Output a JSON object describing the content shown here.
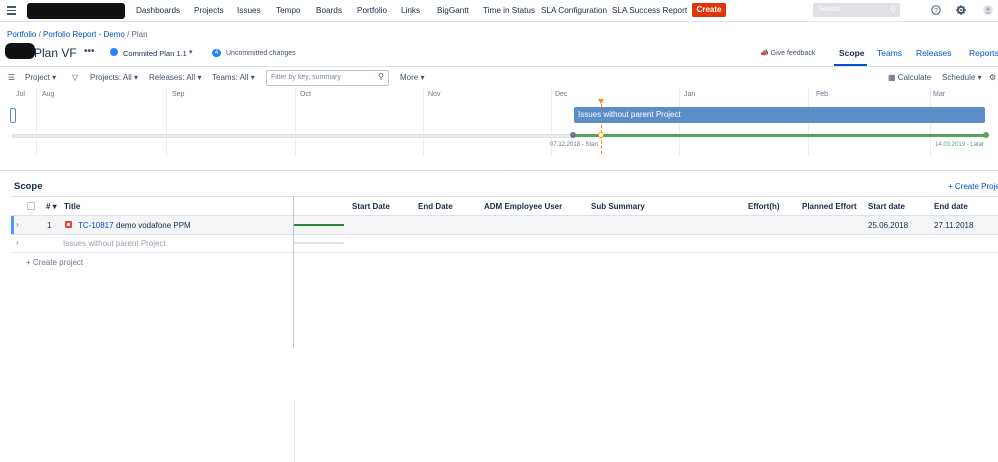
{
  "nav": {
    "items": [
      "Dashboards",
      "Projects",
      "Issues",
      "Tempo",
      "Boards",
      "Portfolio",
      "Links",
      "BigGantt",
      "Time in Status",
      "SLA Configuration",
      "SLA Success Report"
    ],
    "create_label": "Create",
    "search_placeholder": "Search",
    "brand_color": "#de350b"
  },
  "breadcrumb": {
    "portfolio": "Portfolio",
    "report": "Porfolio Report - Demo",
    "current": "Plan"
  },
  "plan": {
    "title": "Plan VF",
    "more": "•••",
    "scenario": "Commited Plan 1.1",
    "uncommitted_count": "4",
    "uncommitted_label": "Uncommitted changes",
    "feedback": "Give feedback",
    "tabs": [
      "Scope",
      "Teams",
      "Releases",
      "Reports"
    ]
  },
  "toolbar": {
    "group_by": "Project",
    "projects": "Projects: All",
    "releases": "Releases: All",
    "teams": "Teams: All",
    "filter_placeholder": "Filter by key, summary",
    "more": "More",
    "calculate": "Calculate",
    "schedule": "Schedule"
  },
  "timeline": {
    "months": [
      "Jul",
      "Aug",
      "Sep",
      "Oct",
      "Nov",
      "Dec",
      "Jan",
      "Feb",
      "Mar"
    ],
    "bar_label": "Issues without parent Project",
    "start_label": "07.12.2018 - Start",
    "end_label": "14.03.2019 - Later"
  },
  "scope": {
    "title": "Scope",
    "create_project": "+ Create Project",
    "columns": {
      "num": "#",
      "title": "Title",
      "start_date": "Start Date",
      "end_date": "End Date",
      "adm_user": "ADM Employee User",
      "sub_summary": "Sub Summary",
      "effort": "Effort(h)",
      "planned_effort": "Planned Effort",
      "start_date2": "Start date",
      "end_date2": "End date"
    },
    "rows": [
      {
        "num": "1",
        "key": "TC-10817",
        "summary": "demo vodafone PPM",
        "start": "25.06.2018",
        "end": "27.11.2018"
      }
    ],
    "no_parent": "Issues without parent Project",
    "create_project_row": "+ Create project"
  }
}
